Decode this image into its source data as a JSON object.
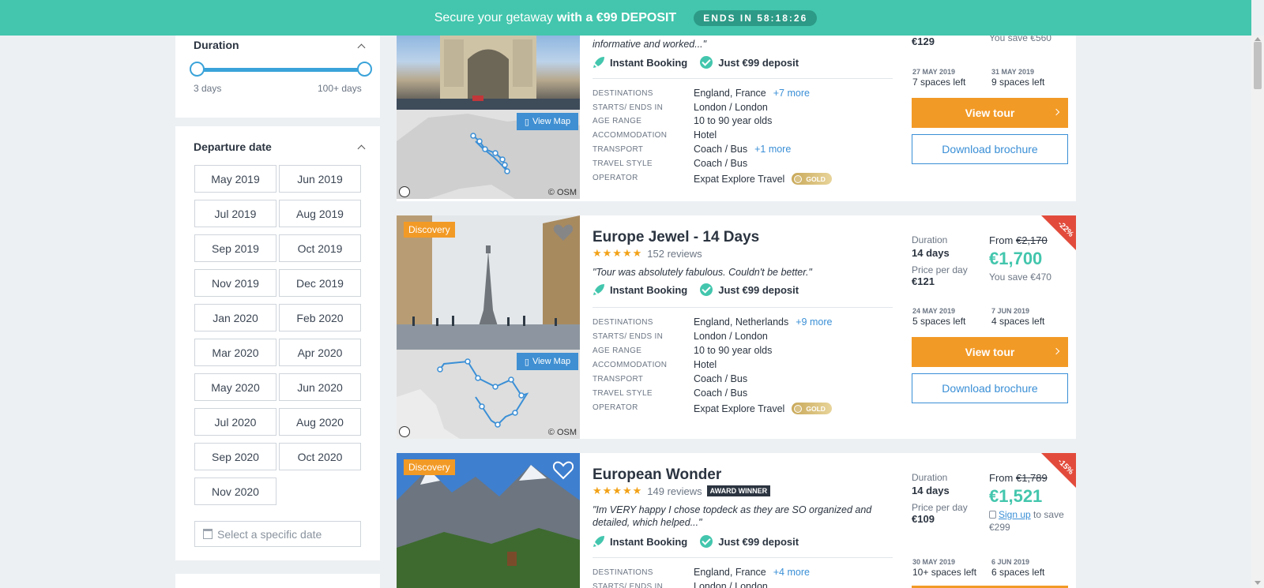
{
  "banner": {
    "text": "Secure your getaway",
    "bold": "with a €99 DEPOSIT",
    "timer": "ENDS IN 58:18:26"
  },
  "filters": {
    "duration": {
      "title": "Duration",
      "min_label": "3 days",
      "max_label": "100+ days"
    },
    "departure": {
      "title": "Departure date",
      "months": [
        "May 2019",
        "Jun 2019",
        "Jul 2019",
        "Aug 2019",
        "Sep 2019",
        "Oct 2019",
        "Nov 2019",
        "Dec 2019",
        "Jan 2020",
        "Feb 2020",
        "Mar 2020",
        "Apr 2020",
        "May 2020",
        "Jun 2020",
        "Jul 2020",
        "Aug 2020",
        "Sep 2020",
        "Oct 2020",
        "Nov 2020"
      ],
      "date_placeholder": "Select a specific date"
    }
  },
  "labels": {
    "destinations": "DESTINATIONS",
    "starts_ends": "STARTS/ ENDS IN",
    "age_range": "AGE RANGE",
    "accommodation": "ACCOMMODATION",
    "transport": "TRANSPORT",
    "travel_style": "TRAVEL STYLE",
    "operator": "OPERATOR",
    "instant": "Instant Booking",
    "deposit": "Just €99 deposit",
    "view_map": "View Map",
    "osm": "© OSM",
    "duration": "Duration",
    "price_per_day": "Price per day",
    "from": "From",
    "view_tour": "View tour",
    "download": "Download brochure",
    "gold": "GOLD",
    "discovery": "Discovery",
    "reviews_suffix": "reviews",
    "award": "AWARD WINNER",
    "sign_up": "Sign up",
    "to_save": "to save"
  },
  "tours": [
    {
      "quote": "informative and worked...\"",
      "destinations": "England, France",
      "dest_more": "+7 more",
      "starts": "London / London",
      "age": "10 to 90 year olds",
      "accommodation": "Hotel",
      "transport": "Coach / Bus",
      "transport_more": "+1 more",
      "style": "Coach / Bus",
      "operator": "Expat Explore Travel",
      "price_per_day": "€129",
      "save": "You save €560",
      "date1": "27 MAY 2019",
      "spaces1": "7 spaces left",
      "date2": "31 MAY 2019",
      "spaces2": "9 spaces left"
    },
    {
      "title": "Europe Jewel - 14 Days",
      "reviews": "152 reviews",
      "quote": "\"Tour was absolutely fabulous. Couldn't be better.\"",
      "destinations": "England, Netherlands",
      "dest_more": "+9 more",
      "starts": "London / London",
      "age": "10 to 90 year olds",
      "accommodation": "Hotel",
      "transport": "Coach / Bus",
      "style": "Coach / Bus",
      "operator": "Expat Explore Travel",
      "duration": "14 days",
      "price_per_day": "€121",
      "old_price": "€2,170",
      "price": "€1,700",
      "save": "You save €470",
      "discount": "-22%",
      "date1": "24 MAY 2019",
      "spaces1": "5 spaces left",
      "date2": "7 JUN 2019",
      "spaces2": "4 spaces left"
    },
    {
      "title": "European Wonder",
      "reviews": "149 reviews",
      "quote": "\"Im VERY happy I chose topdeck as they are SO organized and detailed, which helped...\"",
      "destinations": "England, France",
      "dest_more": "+4 more",
      "starts": "London / London",
      "duration": "14 days",
      "price_per_day": "€109",
      "old_price": "€1,789",
      "price": "€1,521",
      "save_amount": "€299",
      "discount": "-15%",
      "date1": "30 MAY 2019",
      "spaces1": "10+ spaces left",
      "date2": "6 JUN 2019",
      "spaces2": "6 spaces left"
    }
  ],
  "colors": {
    "brand_teal": "#43c6ad",
    "orange": "#f29a26",
    "link_blue": "#3a8fd6",
    "discount_red": "#e24b3b"
  }
}
